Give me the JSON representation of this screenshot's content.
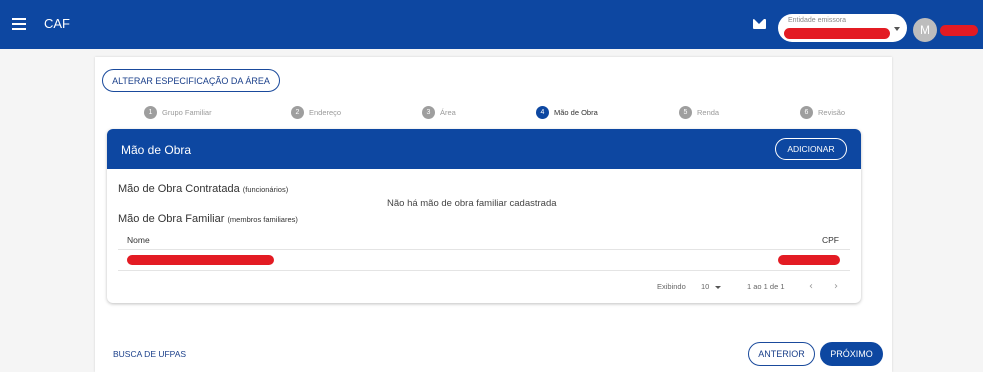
{
  "app": {
    "title": "CAF"
  },
  "header": {
    "entity_select_label": "Entidade emissora",
    "avatar_initial": "M"
  },
  "actions": {
    "change_area_label": "ALTERAR ESPECIFICAÇÃO DA ÁREA"
  },
  "stepper": {
    "steps": [
      {
        "num": "1",
        "label": "Grupo Familiar"
      },
      {
        "num": "2",
        "label": "Endereço"
      },
      {
        "num": "3",
        "label": "Área"
      },
      {
        "num": "4",
        "label": "Mão de Obra"
      },
      {
        "num": "5",
        "label": "Renda"
      },
      {
        "num": "6",
        "label": "Revisão"
      }
    ],
    "active_step": 4
  },
  "labor": {
    "title": "Mão de Obra",
    "add_label": "ADICIONAR",
    "contracted_title": "Mão de Obra Contratada",
    "contracted_note": "(funcionários)",
    "family_title": "Mão de Obra Familiar",
    "family_note": "(membros familiares)",
    "empty_message": "Não há mão de obra familiar cadastrada",
    "columns": [
      "Nome",
      "CPF"
    ],
    "pagination": {
      "showing_label": "Exibindo",
      "page_size": "10",
      "range": "1 ao 1 de 1"
    }
  },
  "footer": {
    "search_link": "BUSCA DE UFPAS",
    "prev_label": "ANTERIOR",
    "next_label": "PRÓXIMO"
  },
  "colors": {
    "primary": "#0d47a1",
    "redaction": "#e31b23"
  }
}
